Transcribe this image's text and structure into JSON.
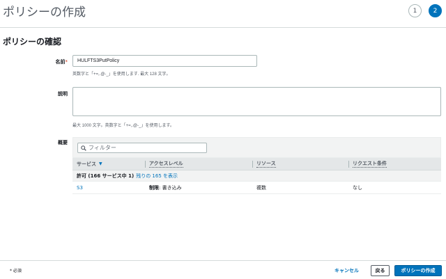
{
  "header": {
    "title": "ポリシーの作成",
    "steps": [
      {
        "label": "1",
        "active": false
      },
      {
        "label": "2",
        "active": true
      }
    ]
  },
  "section_title": "ポリシーの確認",
  "form": {
    "name_label": "名前",
    "required_mark": "*",
    "name_value": "HULFTS3PutPolicy",
    "name_hint": "英数字と「+=,.@-_」を使用します. 最大 128 文字。",
    "description_label": "説明",
    "description_value": "",
    "description_hint": "最大 1000 文字。英数字と「+=,.@-_」を使用します。"
  },
  "summary": {
    "label": "概要",
    "filter_placeholder": "フィルター",
    "columns": [
      "サービス",
      "アクセスレベル",
      "リソース",
      "リクエスト条件"
    ],
    "group": {
      "title": "許可 (166 サービス中 1)",
      "link": "残りの 165 を表示"
    },
    "rows": [
      {
        "service": "S3",
        "access_bold": "制限",
        "access_rest": ": 書き込み",
        "resource": "複数",
        "condition": "なし"
      }
    ]
  },
  "footer": {
    "required_note": "* 必須",
    "cancel_label": "キャンセル",
    "back_label": "戻る",
    "create_label": "ポリシーの作成"
  },
  "colors": {
    "primary": "#0073bb",
    "required": "#d13212"
  }
}
